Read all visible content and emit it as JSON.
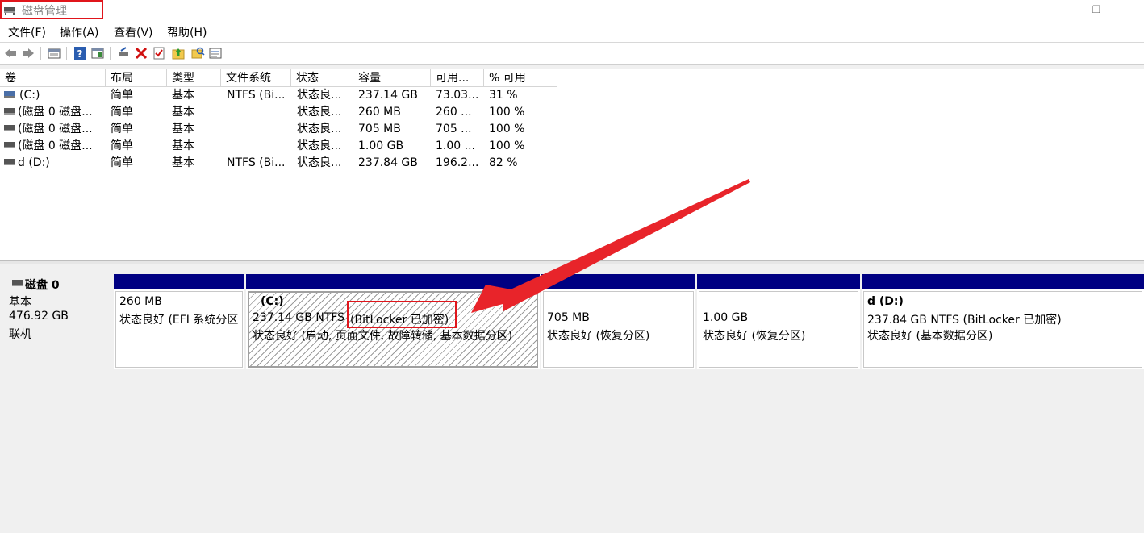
{
  "window": {
    "title": "磁盘管理"
  },
  "menu": [
    "文件(F)",
    "操作(A)",
    "查看(V)",
    "帮助(H)"
  ],
  "columns": [
    "卷",
    "布局",
    "类型",
    "文件系统",
    "状态",
    "容量",
    "可用...",
    "% 可用"
  ],
  "rows": [
    {
      "vol": "(C:)",
      "layout": "简单",
      "type": "基本",
      "fs": "NTFS (Bi...",
      "status": "状态良...",
      "cap": "237.14 GB",
      "free": "73.03...",
      "pct": "31 %"
    },
    {
      "vol": "(磁盘 0 磁盘...",
      "layout": "简单",
      "type": "基本",
      "fs": "",
      "status": "状态良...",
      "cap": "260 MB",
      "free": "260 ...",
      "pct": "100 %"
    },
    {
      "vol": "(磁盘 0 磁盘...",
      "layout": "简单",
      "type": "基本",
      "fs": "",
      "status": "状态良...",
      "cap": "705 MB",
      "free": "705 ...",
      "pct": "100 %"
    },
    {
      "vol": "(磁盘 0 磁盘...",
      "layout": "简单",
      "type": "基本",
      "fs": "",
      "status": "状态良...",
      "cap": "1.00 GB",
      "free": "1.00 ...",
      "pct": "100 %"
    },
    {
      "vol": "d (D:)",
      "layout": "简单",
      "type": "基本",
      "fs": "NTFS (Bi...",
      "status": "状态良...",
      "cap": "237.84 GB",
      "free": "196.2...",
      "pct": "82 %"
    }
  ],
  "disk": {
    "name": "磁盘 0",
    "type": "基本",
    "size": "476.92 GB",
    "state": "联机"
  },
  "partitions": [
    {
      "name": "",
      "size": "260 MB",
      "status": "状态良好 (EFI 系统分区"
    },
    {
      "name": "(C:)",
      "size_fs": "237.14 GB NTFS",
      "enc": "(BitLocker 已加密)",
      "status": "状态良好 (启动, 页面文件, 故障转储, 基本数据分区)"
    },
    {
      "name": "",
      "size": "705 MB",
      "status": "状态良好 (恢复分区)"
    },
    {
      "name": "",
      "size": "1.00 GB",
      "status": "状态良好 (恢复分区)"
    },
    {
      "name": "d  (D:)",
      "size": "237.84 GB NTFS (BitLocker 已加密)",
      "status": "状态良好 (基本数据分区)"
    }
  ],
  "colors": {
    "partition_bar": "#000082",
    "annotation": "#e0151b"
  }
}
